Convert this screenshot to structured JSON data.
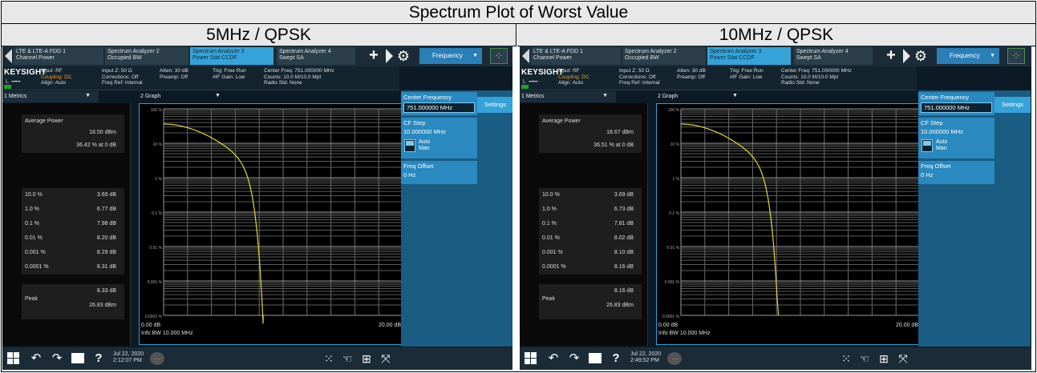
{
  "title": "Spectrum Plot of Worst Value",
  "columns": [
    {
      "header": "5MHz / QPSK",
      "tabs": [
        {
          "line1": "LTE & LTE-A FDD 1",
          "line2": "Channel Power"
        },
        {
          "line1": "Spectrum Analyzer 2",
          "line2": "Occupied BW"
        },
        {
          "line1": "Spectrum Analyzer 3",
          "line2": "Power Stat CCDF"
        },
        {
          "line1": "Spectrum Analyzer 4",
          "line2": "Swept SA"
        }
      ],
      "frequency_button": "Frequency",
      "brand": "KEYSIGHT",
      "info": [
        [
          "Input: RF",
          "Coupling: DC",
          "Align: Auto"
        ],
        [
          "Input Z: 50 Ω",
          "Corrections: Off",
          "Freq Ref: Internal"
        ],
        [
          "Atten: 30 dB",
          "Preamp: Off"
        ],
        [
          "Trig: Free Run",
          "#IF Gain: Low"
        ],
        [
          "Center Freq: 751.000000 MHz",
          "Counts: 10.0 M/10.0 Mpt",
          "Radio Std: None"
        ]
      ],
      "metrics_dropdown": "1 Metrics",
      "graph_dropdown": "2 Graph",
      "avg_power_label": "Average Power",
      "avg_power_value": "18.50 dBm",
      "avg_power_pct": "36.42 % at 0 dB",
      "ccdf": [
        {
          "p": "10.0 %",
          "v": "3.69 dB"
        },
        {
          "p": "1.0 %",
          "v": "6.77 dB"
        },
        {
          "p": "0.1 %",
          "v": "7.98 dB"
        },
        {
          "p": "0.01 %",
          "v": "8.20 dB"
        },
        {
          "p": "0.001 %",
          "v": "8.29 dB"
        },
        {
          "p": "0.0001 %",
          "v": "8.31 dB"
        }
      ],
      "peak_label": "Peak",
      "peak_db": "8.33 dB",
      "peak_dbm": "26.83 dBm",
      "x_start": "0.00 dB",
      "x_end": "20.00 dB",
      "info_bw": "Info BW 10.000 MHz",
      "y_ticks": [
        "100 %",
        "10 %",
        "1 %",
        "0.1 %",
        "0.01 %",
        "0.001 %",
        "0.0001 %"
      ],
      "curve_end_db": 8.33,
      "date": "Jul 22, 2020",
      "time": "2:12:07 PM",
      "settings": {
        "center_freq_label": "Center Frequency",
        "center_freq_value": "751.000000 MHz",
        "cf_step_label": "CF Step",
        "cf_step_value": "10.000000 MHz",
        "auto": "Auto",
        "man": "Man",
        "freq_offset_label": "Freq Offset",
        "freq_offset_value": "0 Hz",
        "settings_tab": "Settings"
      }
    },
    {
      "header": "10MHz / QPSK",
      "tabs": [
        {
          "line1": "LTE & LTE-A FDD 1",
          "line2": "Channel Power"
        },
        {
          "line1": "Spectrum Analyzer 2",
          "line2": "Occupied BW"
        },
        {
          "line1": "Spectrum Analyzer 3",
          "line2": "Power Stat CCDF"
        },
        {
          "line1": "Spectrum Analyzer 4",
          "line2": "Swept SA"
        }
      ],
      "frequency_button": "Frequency",
      "brand": "KEYSIGHT",
      "info": [
        [
          "Input: RF",
          "Coupling: DC",
          "Align: Auto"
        ],
        [
          "Input Z: 50 Ω",
          "Corrections: Off",
          "Freq Ref: Internal"
        ],
        [
          "Atten: 30 dB",
          "Preamp: Off"
        ],
        [
          "Trig: Free Run",
          "#IF Gain: Low"
        ],
        [
          "Center Freq: 751.000000 MHz",
          "Counts: 10.0 M/10.0 Mpt",
          "Radio Std: None"
        ]
      ],
      "metrics_dropdown": "1 Metrics",
      "graph_dropdown": "2 Graph",
      "avg_power_label": "Average Power",
      "avg_power_value": "18.67 dBm",
      "avg_power_pct": "36.51 % at 0 dB",
      "ccdf": [
        {
          "p": "10.0 %",
          "v": "3.69 dB"
        },
        {
          "p": "1.0 %",
          "v": "6.73 dB"
        },
        {
          "p": "0.1 %",
          "v": "7.81 dB"
        },
        {
          "p": "0.01 %",
          "v": "8.02 dB"
        },
        {
          "p": "0.001 %",
          "v": "8.10 dB"
        },
        {
          "p": "0.0001 %",
          "v": "8.16 dB"
        }
      ],
      "peak_label": "Peak",
      "peak_db": "8.16 dB",
      "peak_dbm": "26.83 dBm",
      "x_start": "0.00 dB",
      "x_end": "20.00 dB",
      "info_bw": "Info BW 10.000 MHz",
      "y_ticks": [
        "100 %",
        "10 %",
        "1 %",
        "0.1 %",
        "0.01 %",
        "0.001 %",
        "0.0001 %"
      ],
      "curve_end_db": 8.16,
      "date": "Jul 22, 2020",
      "time": "2:49:52 PM",
      "settings": {
        "center_freq_label": "Center Frequency",
        "center_freq_value": "751.000000 MHz",
        "cf_step_label": "CF Step",
        "cf_step_value": "10.000000 MHz",
        "auto": "Auto",
        "man": "Man",
        "freq_offset_label": "Freq Offset",
        "freq_offset_value": "0 Hz",
        "settings_tab": "Settings"
      }
    }
  ],
  "colors": {
    "trace": "#e0d83a",
    "accent": "#35a3d8",
    "panel": "#2a89bf"
  }
}
